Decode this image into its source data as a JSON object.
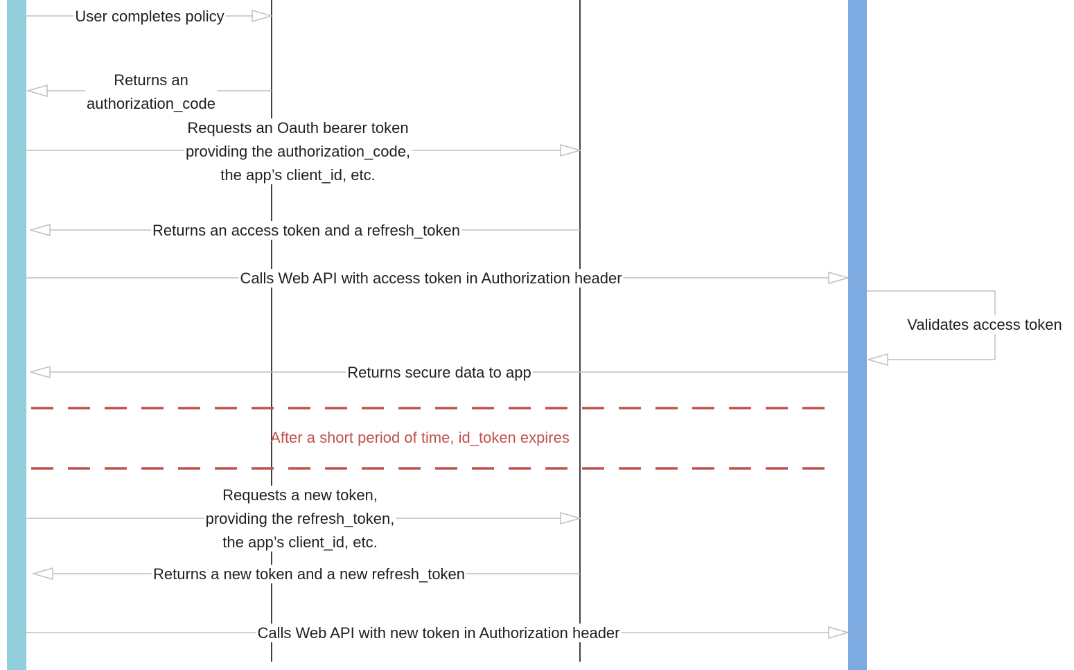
{
  "colors": {
    "client_lifeline": "#92cddc",
    "api_lifeline": "#7eaae2",
    "lifeline_gray": "#404040",
    "arrow": "#bfbfbf",
    "separator": "#c0504d",
    "text": "#1f1f1f"
  },
  "messages": [
    {
      "id": "user-completes-policy",
      "from": "client",
      "to": "policy",
      "lines": [
        "User completes policy"
      ]
    },
    {
      "id": "returns-authorization-code",
      "from": "policy",
      "to": "client",
      "lines": [
        "Returns an",
        "authorization_code"
      ]
    },
    {
      "id": "requests-bearer-token",
      "from": "client",
      "to": "token",
      "lines": [
        "Requests an Oauth bearer token",
        "providing the authorization_code,",
        "the app’s client_id, etc."
      ]
    },
    {
      "id": "returns-access-and-refresh-token",
      "from": "token",
      "to": "client",
      "lines": [
        "Returns an access token and a refresh_token"
      ]
    },
    {
      "id": "calls-web-api-access-token",
      "from": "client",
      "to": "api",
      "lines": [
        "Calls Web API with access token in Authorization header"
      ]
    },
    {
      "id": "validates-access-token",
      "from": "api",
      "to": "api",
      "self": true,
      "lines": [
        "Validates access token"
      ]
    },
    {
      "id": "returns-secure-data",
      "from": "api",
      "to": "client",
      "lines": [
        "Returns secure data to app"
      ]
    },
    {
      "id": "requests-new-token",
      "from": "client",
      "to": "token",
      "lines": [
        "Requests a new token,",
        "providing the refresh_token,",
        "the app’s client_id, etc."
      ]
    },
    {
      "id": "returns-new-token-and-refresh",
      "from": "token",
      "to": "client",
      "lines": [
        "Returns a new token and a new refresh_token"
      ]
    },
    {
      "id": "calls-web-api-new-token",
      "from": "client",
      "to": "api",
      "lines": [
        "Calls Web API with new token in Authorization header"
      ]
    }
  ],
  "separator": {
    "label": "After a short period of time, id_token expires"
  }
}
